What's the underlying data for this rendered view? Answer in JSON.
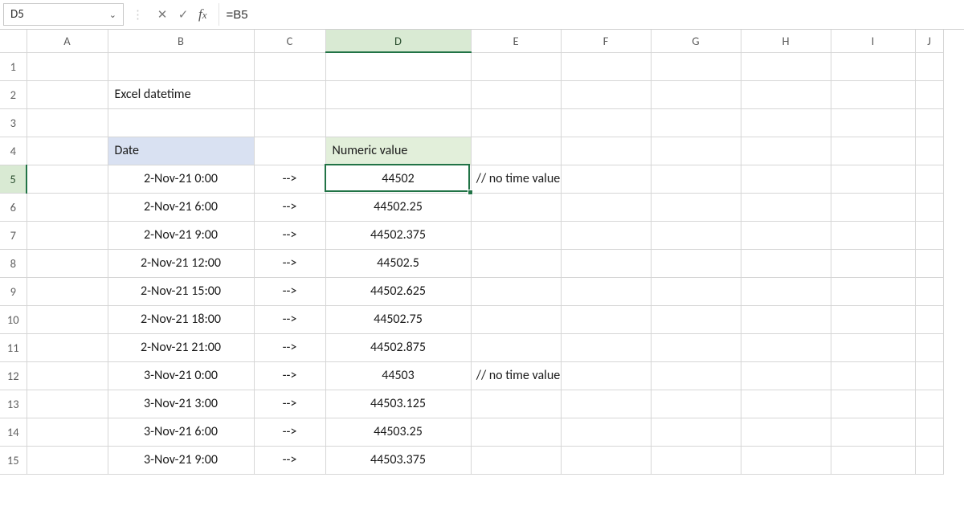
{
  "formula_bar": {
    "name_box": "D5",
    "formula": "=B5"
  },
  "title": "Excel datetime",
  "headers": {
    "date": "Date",
    "numeric": "Numeric value"
  },
  "arrow": "-->",
  "comments": {
    "no_time": "// no time value"
  },
  "rows": [
    {
      "date": "2-Nov-21 0:00",
      "value": "44502",
      "comment": "no_time"
    },
    {
      "date": "2-Nov-21 6:00",
      "value": "44502.25",
      "comment": ""
    },
    {
      "date": "2-Nov-21 9:00",
      "value": "44502.375",
      "comment": ""
    },
    {
      "date": "2-Nov-21 12:00",
      "value": "44502.5",
      "comment": ""
    },
    {
      "date": "2-Nov-21 15:00",
      "value": "44502.625",
      "comment": ""
    },
    {
      "date": "2-Nov-21 18:00",
      "value": "44502.75",
      "comment": ""
    },
    {
      "date": "2-Nov-21 21:00",
      "value": "44502.875",
      "comment": ""
    },
    {
      "date": "3-Nov-21 0:00",
      "value": "44503",
      "comment": "no_time"
    },
    {
      "date": "3-Nov-21 3:00",
      "value": "44503.125",
      "comment": ""
    },
    {
      "date": "3-Nov-21 6:00",
      "value": "44503.25",
      "comment": ""
    },
    {
      "date": "3-Nov-21 9:00",
      "value": "44503.375",
      "comment": ""
    }
  ],
  "columns": [
    "A",
    "B",
    "C",
    "D",
    "E",
    "F",
    "G",
    "H",
    "I",
    "J"
  ],
  "row_numbers": [
    1,
    2,
    3,
    4,
    5,
    6,
    7,
    8,
    9,
    10,
    11,
    12,
    13,
    14,
    15
  ],
  "selected_cell": "D5"
}
